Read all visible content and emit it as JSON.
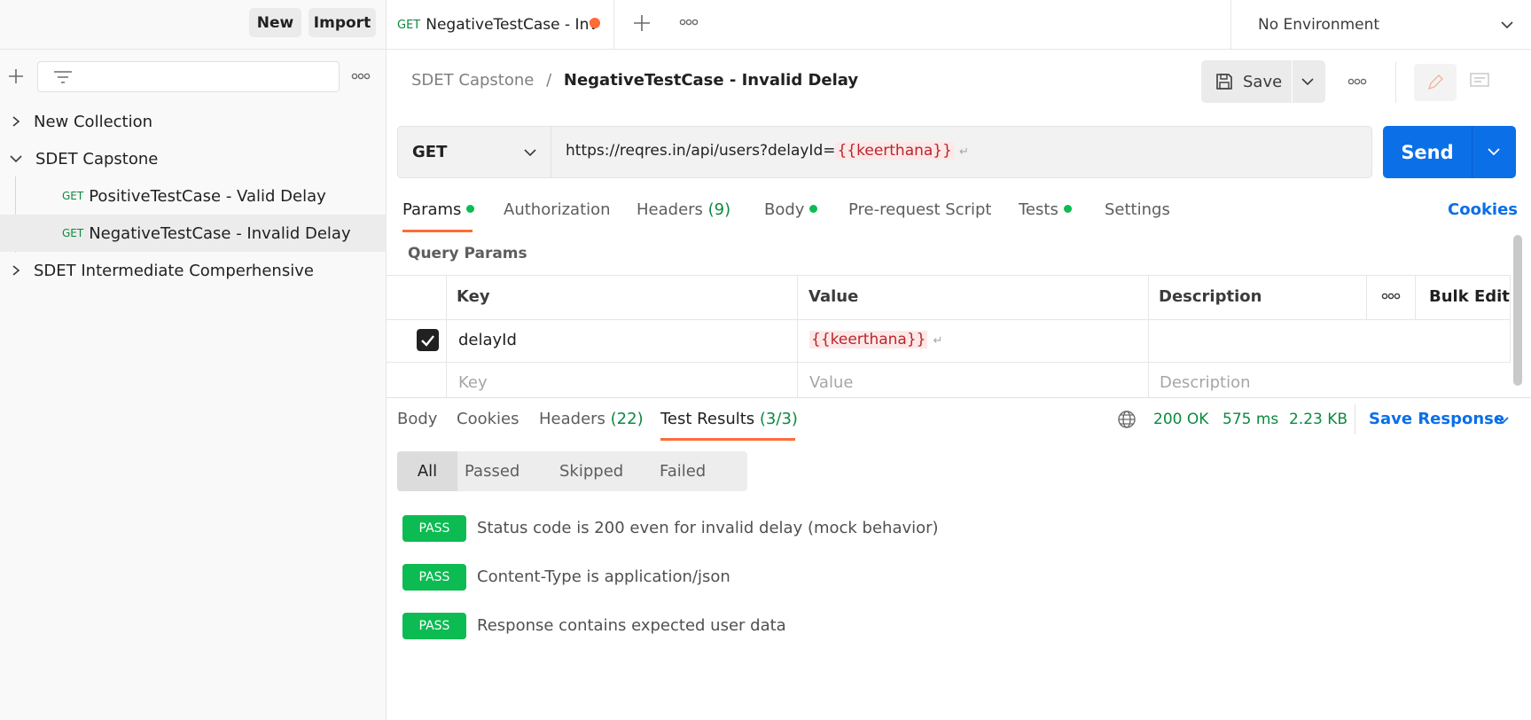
{
  "sidebar": {
    "new_label": "New",
    "import_label": "Import",
    "tree": [
      {
        "label": "New Collection"
      },
      {
        "label": "SDET Capstone"
      },
      {
        "method": "GET",
        "label": "PositiveTestCase - Valid Delay"
      },
      {
        "method": "GET",
        "label": "NegativeTestCase - Invalid Delay"
      },
      {
        "label": "SDET Intermediate Comperhensive"
      }
    ]
  },
  "topbar": {
    "tab_method": "GET",
    "tab_title": "NegativeTestCase - Inv",
    "environment": "No Environment"
  },
  "request": {
    "breadcrumb_parent": "SDET Capstone",
    "breadcrumb_sep": "/",
    "title": "NegativeTestCase - Invalid Delay",
    "save_label": "Save",
    "method": "GET",
    "url_prefix": "https://reqres.in/api/users?delayId=",
    "url_variable": "{{keerthana}}",
    "send_label": "Send"
  },
  "request_tabs": {
    "params": "Params",
    "authorization": "Authorization",
    "headers": "Headers",
    "headers_count": "(9)",
    "body": "Body",
    "prerequest": "Pre-request Script",
    "tests": "Tests",
    "settings": "Settings",
    "cookies": "Cookies"
  },
  "params": {
    "section_title": "Query Params",
    "headers": {
      "key": "Key",
      "value": "Value",
      "description": "Description",
      "bulk_edit": "Bulk Edit"
    },
    "rows": [
      {
        "checked": true,
        "key": "delayId",
        "value": "{{keerthana}}",
        "description": ""
      }
    ],
    "placeholders": {
      "key": "Key",
      "value": "Value",
      "description": "Description"
    }
  },
  "response": {
    "tabs": {
      "body": "Body",
      "cookies": "Cookies",
      "headers": "Headers",
      "headers_count": "(22)",
      "test_results": "Test Results",
      "test_results_count": "(3/3)"
    },
    "status": "200 OK",
    "time": "575 ms",
    "size": "2.23 KB",
    "save_response": "Save Response",
    "filters": [
      "All",
      "Passed",
      "Skipped",
      "Failed"
    ],
    "results": [
      {
        "badge": "PASS",
        "text": "Status code is 200 even for invalid delay (mock behavior)"
      },
      {
        "badge": "PASS",
        "text": "Content-Type is application/json"
      },
      {
        "badge": "PASS",
        "text": "Response contains expected user data"
      }
    ]
  },
  "colors": {
    "accent": "#ff6c37",
    "send_blue": "#0b6fe8",
    "pass_green": "#0cbb52",
    "variable_red": "#b8262b"
  }
}
